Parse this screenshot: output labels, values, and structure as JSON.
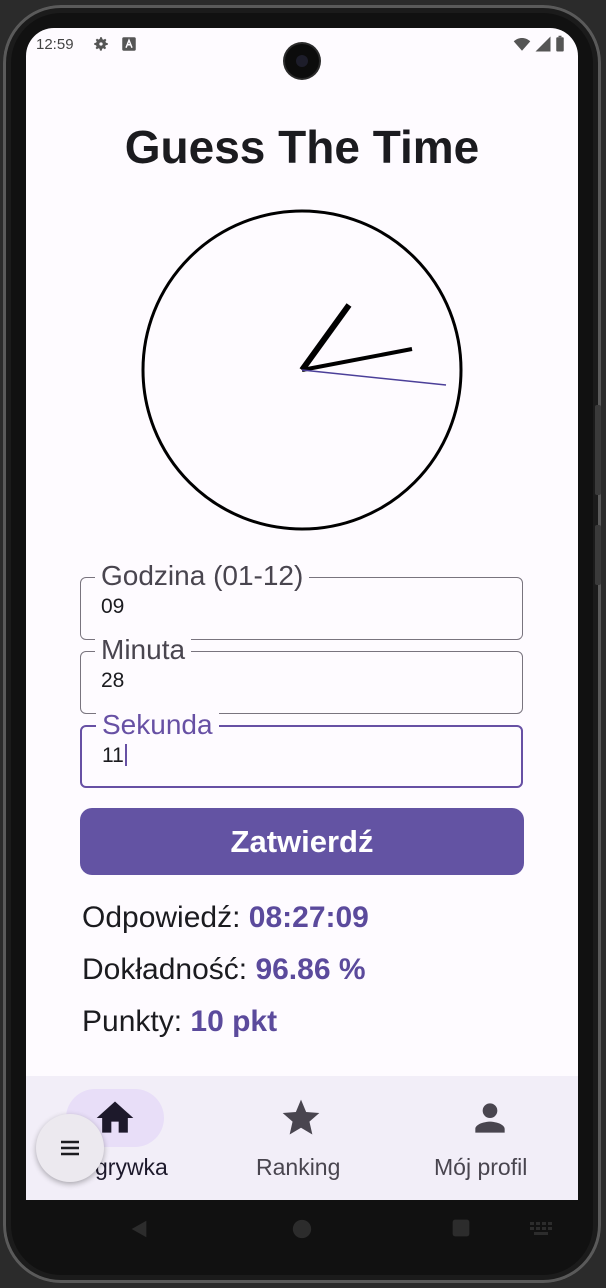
{
  "status_bar": {
    "time": "12:59"
  },
  "app": {
    "title": "Guess The Time"
  },
  "form": {
    "hour": {
      "label": "Godzina (01-12)",
      "value": "09"
    },
    "minute": {
      "label": "Minuta",
      "value": "28"
    },
    "second": {
      "label": "Sekunda",
      "value": "11"
    },
    "submit_label": "Zatwierdź"
  },
  "results": {
    "answer_label": "Odpowiedź:",
    "answer_value": "08:27:09",
    "accuracy_label": "Dokładność:",
    "accuracy_value": "96.86 %",
    "points_label": "Punkty:",
    "points_value": "10 pkt"
  },
  "bottom_nav": {
    "items": [
      {
        "label": "Rozgrywka",
        "visible_label": "grywka",
        "icon": "home-icon",
        "selected": true
      },
      {
        "label": "Ranking",
        "icon": "star-icon",
        "selected": false
      },
      {
        "label": "Mój profil",
        "icon": "person-icon",
        "selected": false
      }
    ]
  },
  "colors": {
    "accent": "#6750a4",
    "button": "#6353a3",
    "value": "#5b4a9c"
  }
}
